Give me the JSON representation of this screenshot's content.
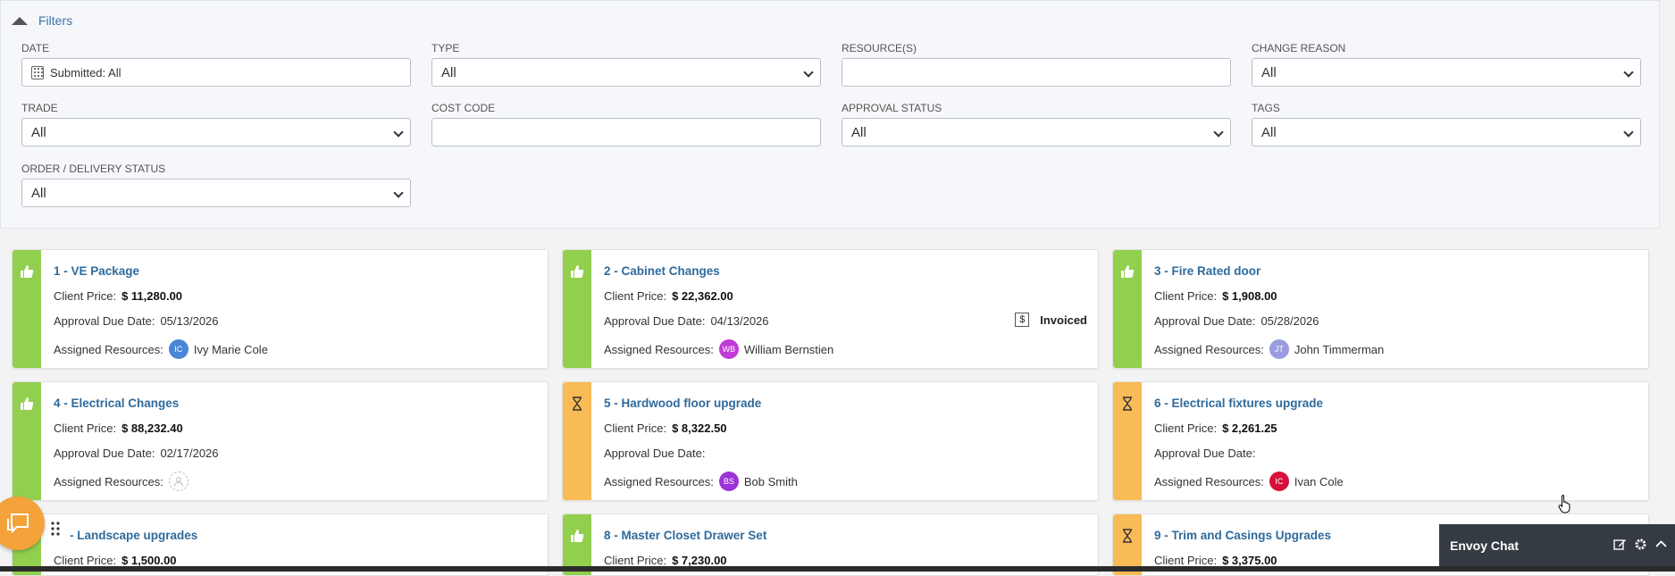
{
  "filters": {
    "toggle_label": "Filters",
    "date": {
      "label": "DATE",
      "value": "Submitted: All"
    },
    "type": {
      "label": "TYPE",
      "value": "All"
    },
    "resources": {
      "label": "RESOURCE(S)",
      "value": ""
    },
    "change_reason": {
      "label": "CHANGE REASON",
      "value": "All"
    },
    "trade": {
      "label": "TRADE",
      "value": "All"
    },
    "cost_code": {
      "label": "COST CODE",
      "value": ""
    },
    "approval_status": {
      "label": "APPROVAL STATUS",
      "value": "All"
    },
    "tags": {
      "label": "TAGS",
      "value": "All"
    },
    "order_delivery": {
      "label": "ORDER / DELIVERY STATUS",
      "value": "All"
    }
  },
  "labels": {
    "client_price": "Client Price:",
    "approval_due": "Approval Due Date:",
    "assigned": "Assigned Resources:",
    "invoiced": "Invoiced",
    "dollar": "$"
  },
  "cards": [
    {
      "title": "1 - VE Package",
      "price": "$ 11,280.00",
      "due": "05/13/2026",
      "initials": "IC",
      "resource": "Ivy Marie Cole",
      "status": "approved",
      "avatar_color": "#4a86d6"
    },
    {
      "title": "2 - Cabinet Changes",
      "price": "$ 22,362.00",
      "due": "04/13/2026",
      "initials": "WB",
      "resource": "William Bernstien",
      "status": "approved",
      "avatar_color": "#c03ad6"
    },
    {
      "title": "3 - Fire Rated door",
      "price": "$ 1,908.00",
      "due": "05/28/2026",
      "initials": "JT",
      "resource": "John Timmerman",
      "status": "approved",
      "avatar_color": "#9a9be0"
    },
    {
      "title": "4 - Electrical Changes",
      "price": "$ 88,232.40",
      "due": "02/17/2026",
      "initials": "",
      "resource": "",
      "status": "approved",
      "avatar_color": ""
    },
    {
      "title": "5 - Hardwood floor upgrade",
      "price": "$ 8,322.50",
      "due": "",
      "initials": "BS",
      "resource": "Bob Smith",
      "status": "pending",
      "avatar_color": "#9b34d8"
    },
    {
      "title": "6 - Electrical fixtures upgrade",
      "price": "$ 2,261.25",
      "due": "",
      "initials": "IC",
      "resource": "Ivan Cole",
      "status": "pending",
      "avatar_color": "#d6103a"
    },
    {
      "title": "- Landscape upgrades",
      "price": "$ 1,500.00",
      "status": "approved"
    },
    {
      "title": "8 - Master Closet Drawer Set",
      "price": "$ 7,230.00",
      "status": "approved"
    },
    {
      "title": "9 - Trim and Casings Upgrades",
      "price": "$ 3,375.00",
      "status": "pending"
    }
  ],
  "envoy_chat": {
    "title": "Envoy Chat"
  },
  "colors": {
    "approved": "#92cf4f",
    "pending": "#f8bb55",
    "link": "#2f6a9c",
    "fab": "#f5a23b",
    "chat_bar": "#353b42"
  }
}
